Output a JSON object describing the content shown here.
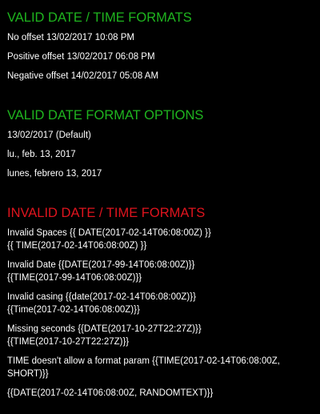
{
  "colors": {
    "background": "#000000",
    "valid_heading": "#1fb51f",
    "invalid_heading": "#e0141e",
    "text": "#ffffff"
  },
  "valid_formats": {
    "title": "VALID DATE / TIME FORMATS",
    "items": [
      "No offset 13/02/2017 10:08 PM",
      "Positive offset 13/02/2017 06:08 PM",
      "Negative offset 14/02/2017 05:08 AM"
    ]
  },
  "format_options": {
    "title": "VALID DATE FORMAT OPTIONS",
    "items": [
      "13/02/2017 (Default)",
      "lu., feb. 13, 2017",
      "lunes, febrero 13, 2017"
    ]
  },
  "invalid_formats": {
    "title": "INVALID DATE / TIME FORMATS",
    "items": [
      [
        "Invalid Spaces {{ DATE(2017-02-14T06:08:00Z) }}",
        "{{ TIME(2017-02-14T06:08:00Z) }}"
      ],
      [
        "Invalid Date {{DATE(2017-99-14T06:08:00Z)}}",
        "{{TIME(2017-99-14T06:08:00Z)}}"
      ],
      [
        "Invalid casing {{date(2017-02-14T06:08:00Z)}}",
        "{{Time(2017-02-14T06:08:00Z)}}"
      ],
      [
        "Missing seconds {{DATE(2017-10-27T22:27Z)}}",
        "{{TIME(2017-10-27T22:27Z)}}"
      ],
      [
        "TIME doesn't allow a format param {{TIME(2017-02-14T06:08:00Z,",
        "SHORT)}}"
      ],
      [
        "{{DATE(2017-02-14T06:08:00Z, RANDOMTEXT)}}"
      ]
    ]
  }
}
